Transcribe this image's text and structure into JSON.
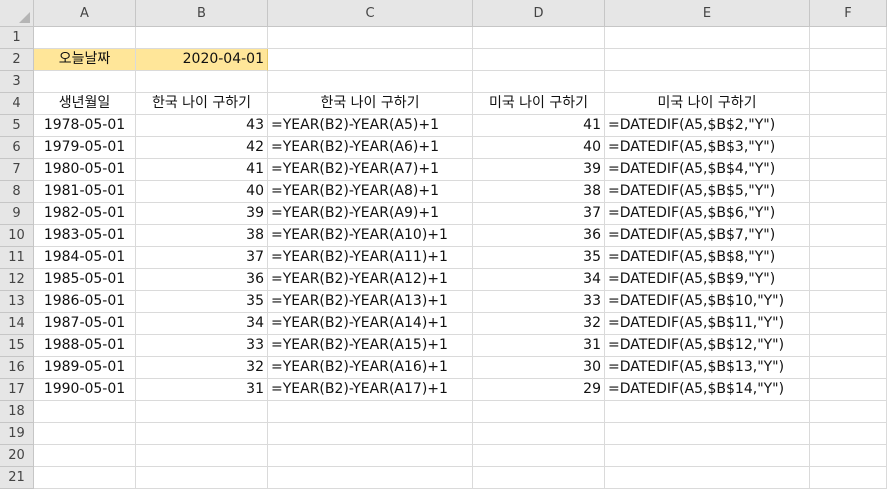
{
  "sheet": {
    "columns": [
      "A",
      "B",
      "C",
      "D",
      "E",
      "F"
    ],
    "rows": [
      "1",
      "2",
      "3",
      "4",
      "5",
      "6",
      "7",
      "8",
      "9",
      "10",
      "11",
      "12",
      "13",
      "14",
      "15",
      "16",
      "17",
      "18",
      "19",
      "20",
      "21"
    ],
    "label_cell": "오늘날짜",
    "today_cell": "2020-04-01",
    "headers": {
      "a": "생년월일",
      "b": "한국 나이 구하기",
      "c": "한국 나이 구하기",
      "d": "미국 나이 구하기",
      "e": "미국 나이 구하기"
    },
    "data_rows": [
      {
        "birth": "1978-05-01",
        "kr_age": "43",
        "kr_formula": "=YEAR(B2)-YEAR(A5)+1",
        "us_age": "41",
        "us_formula": "=DATEDIF(A5,$B$2,\"Y\")"
      },
      {
        "birth": "1979-05-01",
        "kr_age": "42",
        "kr_formula": "=YEAR(B2)-YEAR(A6)+1",
        "us_age": "40",
        "us_formula": "=DATEDIF(A5,$B$3,\"Y\")"
      },
      {
        "birth": "1980-05-01",
        "kr_age": "41",
        "kr_formula": "=YEAR(B2)-YEAR(A7)+1",
        "us_age": "39",
        "us_formula": "=DATEDIF(A5,$B$4,\"Y\")"
      },
      {
        "birth": "1981-05-01",
        "kr_age": "40",
        "kr_formula": "=YEAR(B2)-YEAR(A8)+1",
        "us_age": "38",
        "us_formula": "=DATEDIF(A5,$B$5,\"Y\")"
      },
      {
        "birth": "1982-05-01",
        "kr_age": "39",
        "kr_formula": "=YEAR(B2)-YEAR(A9)+1",
        "us_age": "37",
        "us_formula": "=DATEDIF(A5,$B$6,\"Y\")"
      },
      {
        "birth": "1983-05-01",
        "kr_age": "38",
        "kr_formula": "=YEAR(B2)-YEAR(A10)+1",
        "us_age": "36",
        "us_formula": "=DATEDIF(A5,$B$7,\"Y\")"
      },
      {
        "birth": "1984-05-01",
        "kr_age": "37",
        "kr_formula": "=YEAR(B2)-YEAR(A11)+1",
        "us_age": "35",
        "us_formula": "=DATEDIF(A5,$B$8,\"Y\")"
      },
      {
        "birth": "1985-05-01",
        "kr_age": "36",
        "kr_formula": "=YEAR(B2)-YEAR(A12)+1",
        "us_age": "34",
        "us_formula": "=DATEDIF(A5,$B$9,\"Y\")"
      },
      {
        "birth": "1986-05-01",
        "kr_age": "35",
        "kr_formula": "=YEAR(B2)-YEAR(A13)+1",
        "us_age": "33",
        "us_formula": "=DATEDIF(A5,$B$10,\"Y\")"
      },
      {
        "birth": "1987-05-01",
        "kr_age": "34",
        "kr_formula": "=YEAR(B2)-YEAR(A14)+1",
        "us_age": "32",
        "us_formula": "=DATEDIF(A5,$B$11,\"Y\")"
      },
      {
        "birth": "1988-05-01",
        "kr_age": "33",
        "kr_formula": "=YEAR(B2)-YEAR(A15)+1",
        "us_age": "31",
        "us_formula": "=DATEDIF(A5,$B$12,\"Y\")"
      },
      {
        "birth": "1989-05-01",
        "kr_age": "32",
        "kr_formula": "=YEAR(B2)-YEAR(A16)+1",
        "us_age": "30",
        "us_formula": "=DATEDIF(A5,$B$13,\"Y\")"
      },
      {
        "birth": "1990-05-01",
        "kr_age": "31",
        "kr_formula": "=YEAR(B2)-YEAR(A17)+1",
        "us_age": "29",
        "us_formula": "=DATEDIF(A5,$B$14,\"Y\")"
      }
    ],
    "highlight_color": "#ffe699"
  }
}
